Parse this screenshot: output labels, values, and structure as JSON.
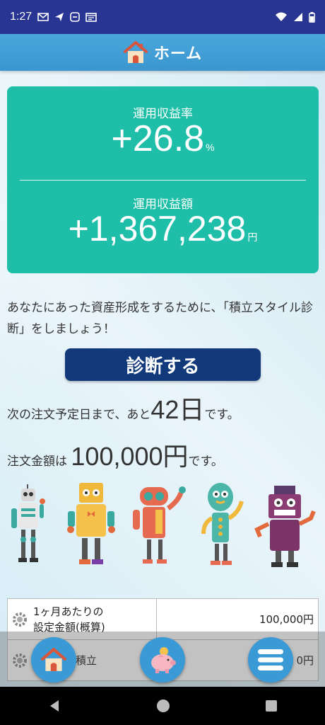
{
  "status_bar": {
    "time": "1:27",
    "left_icons": [
      "gmail-icon",
      "telegram-icon",
      "app-icon",
      "news-icon"
    ],
    "right_icons": [
      "wifi-icon",
      "signal-icon",
      "battery-icon"
    ]
  },
  "header": {
    "title": "ホーム",
    "icon": "house-icon"
  },
  "summary": {
    "rate_label": "運用収益率",
    "rate_value": "+26.8",
    "rate_unit": "%",
    "amount_label": "運用収益額",
    "amount_value": "+1,367,238",
    "amount_unit": "円",
    "card_color": "#1fbea8"
  },
  "intro_text": "あなたにあった資産形成をするために、「積立スタイル診断」をしましょう！",
  "diagnose_button": "診断する",
  "next_order": {
    "prefix": "次の注文予定日まで、あと",
    "days": "42日",
    "suffix": "です。"
  },
  "order_amount": {
    "prefix": "注文金額は ",
    "amount": "100,000円",
    "suffix": "です。"
  },
  "settings_rows": [
    {
      "label_line1": "1ヶ月あたりの",
      "label_line2": "設定金額(概算)",
      "value": "100,000円"
    },
    {
      "label_line1": "ボーナス積立",
      "label_line2": "",
      "value": "0円"
    }
  ],
  "bottom_buttons": [
    {
      "name": "home-fab",
      "icon": "house-icon"
    },
    {
      "name": "piggy-fab",
      "icon": "piggy-bank-icon"
    },
    {
      "name": "menu-fab",
      "icon": "hamburger-menu-icon"
    }
  ],
  "nav_bar": [
    "back-icon",
    "home-circle-icon",
    "recents-icon"
  ],
  "colors": {
    "status_bar": "#283593",
    "header": "#3b95cf",
    "diagnose_button": "#123a7a",
    "fab": "#3a9ad6"
  }
}
